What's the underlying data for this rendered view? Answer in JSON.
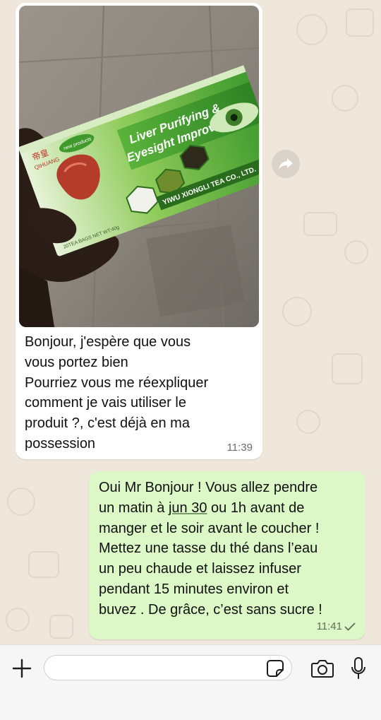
{
  "chat": {
    "incoming": {
      "photo": {
        "product_name": "Liver Purifying & Eyesight Improving Tea",
        "brand_label": "QIHUANG",
        "brand_chinese": "帝皇",
        "badge_text": "new products",
        "company": "YIWU XIONGLI TEA CO., LTD.",
        "package_info": "20TEA BAGS NET WT:40g"
      },
      "text_lines": [
        "Bonjour, j'espère que vous",
        "vous portez bien",
        "Pourriez vous me réexpliquer",
        "comment je vais utiliser le",
        "produit ?, c'est déjà en ma",
        "possession"
      ],
      "time": "11:39"
    },
    "forward_icon": "forward-arrow-icon",
    "outgoing": {
      "line1": "Oui Mr Bonjour ! Vous allez pendre",
      "line2_before": "un matin à ",
      "line2_link": "jun 30",
      "line2_after": " ou 1h avant de",
      "lines_rest": [
        "manger et le soir avant le coucher !",
        "Mettez une tasse du thé dans l’eau",
        "un peu chaude et laissez infuser",
        "pendant 15 minutes environ et",
        "buvez . De grâce, c’est sans sucre !"
      ],
      "time": "11:41",
      "status_icon": "single-check-icon"
    }
  },
  "composer": {
    "input_value": "",
    "input_placeholder": "",
    "icons": [
      "plus-icon",
      "sticker-icon",
      "camera-icon",
      "microphone-icon"
    ]
  }
}
